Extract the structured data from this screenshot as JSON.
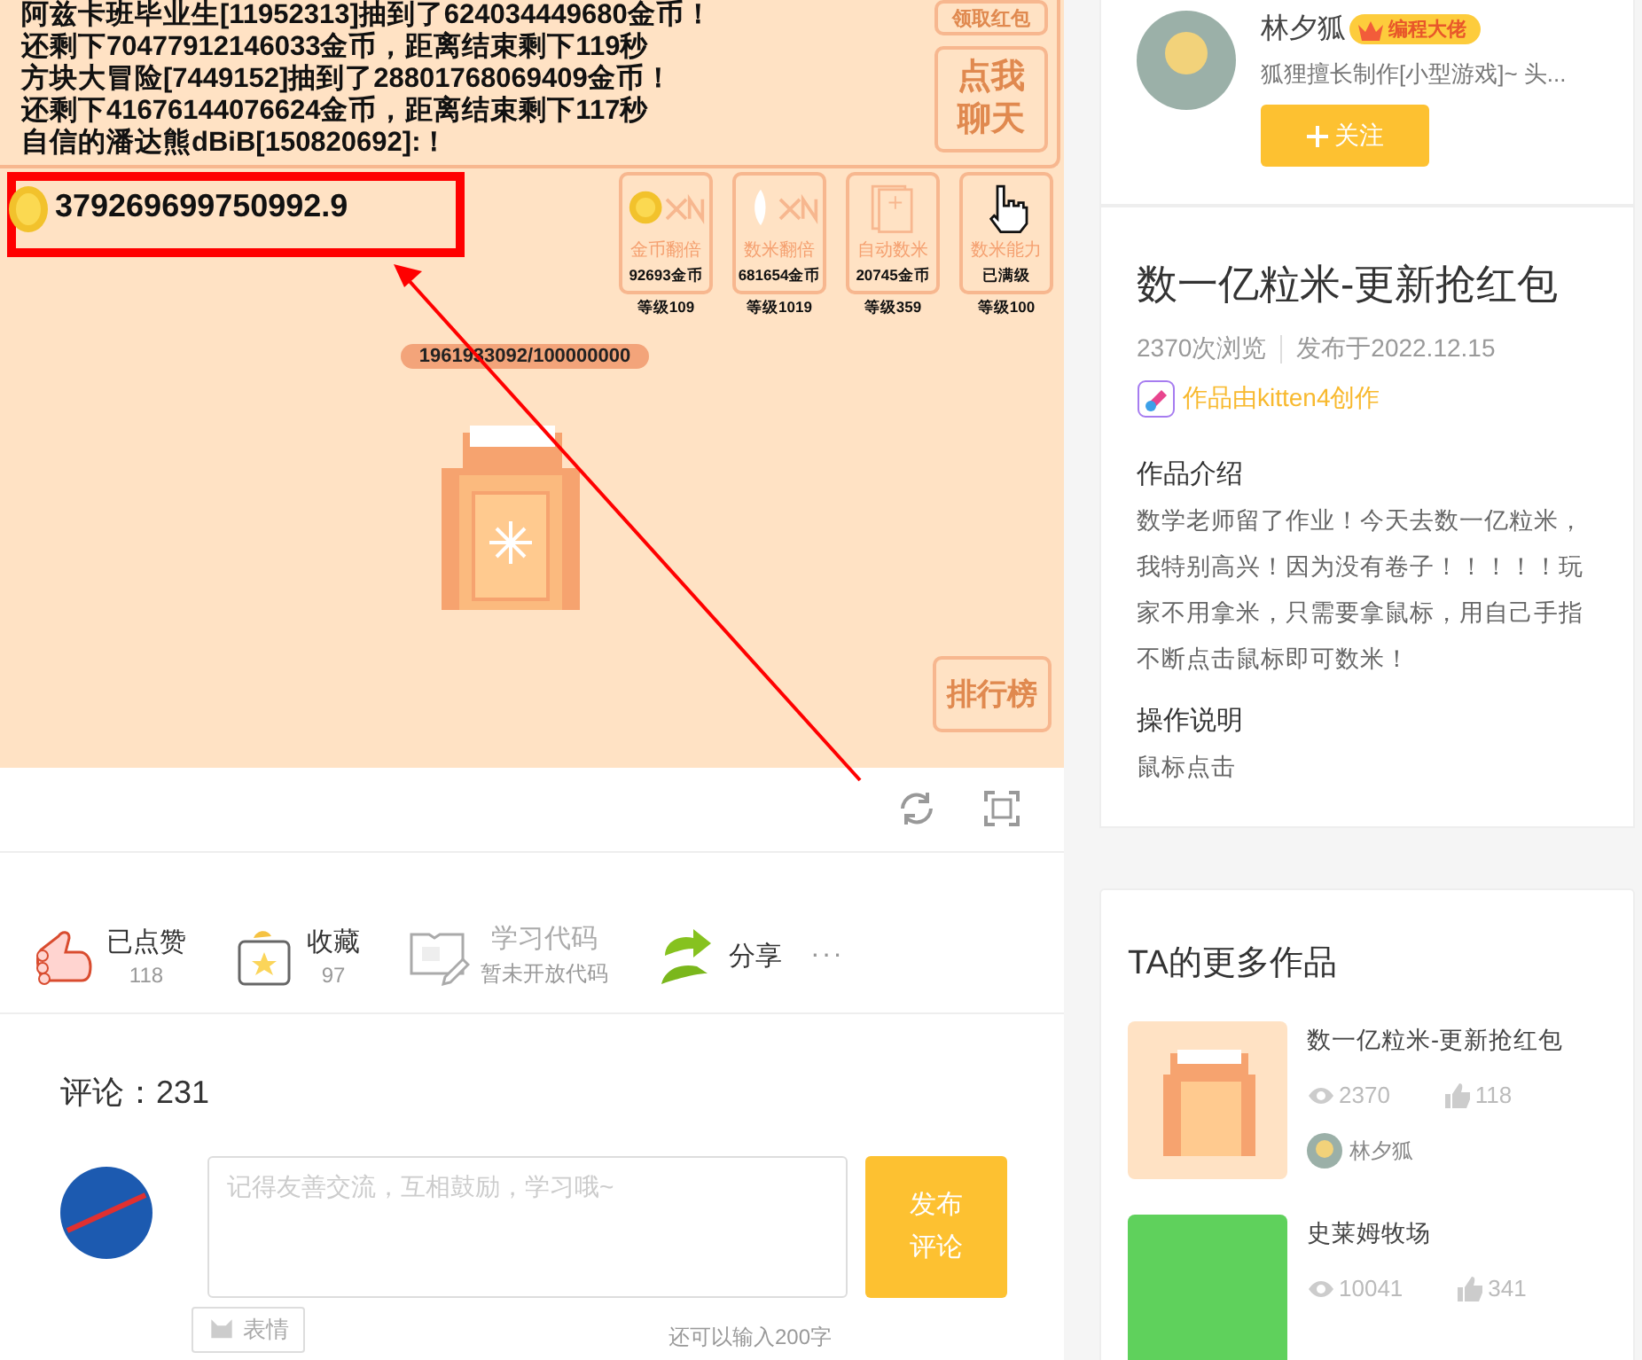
{
  "game": {
    "chat_lines": [
      "阿兹卡班毕业生[11952313]抽到了624034449680金币！",
      "还剩下70477912146033金币，距离结束剩下119秒",
      "方块大冒险[7449152]抽到了28801768069409金币！",
      "还剩下41676144076624金币，距离结束剩下117秒",
      "自信的潘达熊dBiB[150820692]:！"
    ],
    "side_buttons": [
      "领取红包",
      "点我聊天"
    ],
    "score": "379269699750992.9",
    "upgrades": [
      {
        "kind": "coin",
        "label": "金币翻倍",
        "cost": "92693金币",
        "level": "等级109"
      },
      {
        "kind": "rice",
        "label": "数米翻倍",
        "cost": "681654金币",
        "level": "等级1019"
      },
      {
        "kind": "card",
        "label": "自动数米",
        "cost": "20745金币",
        "level": "等级359"
      },
      {
        "kind": "hand",
        "label": "数米能力",
        "cost": "已满级",
        "level": "等级100"
      }
    ],
    "progress": "1961933092/100000000",
    "rank_button": "排行榜"
  },
  "actions": [
    {
      "kind": "like",
      "label": "已点赞",
      "count": "118"
    },
    {
      "kind": "collect",
      "label": "收藏",
      "count": "97"
    },
    {
      "kind": "code",
      "label": "学习代码",
      "count": "暂未开放代码",
      "disabled": true
    },
    {
      "kind": "share",
      "label": "分享"
    },
    {
      "kind": "more",
      "label": "···"
    }
  ],
  "comments": {
    "title": "评论：231",
    "placeholder": "记得友善交流，互相鼓励，学习哦~",
    "submit": "发布评论",
    "emoji_button": "表情",
    "remaining": "还可以输入200字"
  },
  "author": {
    "name": "林夕狐",
    "badge": "编程大佬",
    "bio": "狐狸擅长制作[小型游戏]~ 头...",
    "follow": "关注"
  },
  "work": {
    "title": "数一亿粒米-更新抢红包",
    "views": "2370次浏览",
    "published": "发布于2022.12.15",
    "creator": "作品由kitten4创作",
    "intro_title": "作品介绍",
    "intro": "数学老师留了作业！今天去数一亿粒米，我特别高兴！因为没有卷子！！！！！玩家不用拿米，只需要拿鼠标，用自己手指不断点击鼠标即可数米！",
    "howto_title": "操作说明",
    "howto": "鼠标点击"
  },
  "more_works": {
    "title": "TA的更多作品",
    "items": [
      {
        "kind": "rice",
        "title": "数一亿粒米-更新抢红包",
        "views": "2370",
        "likes": "118",
        "author": "林夕狐"
      },
      {
        "kind": "slime",
        "title": "史莱姆牧场",
        "views": "10041",
        "likes": "341"
      }
    ]
  }
}
